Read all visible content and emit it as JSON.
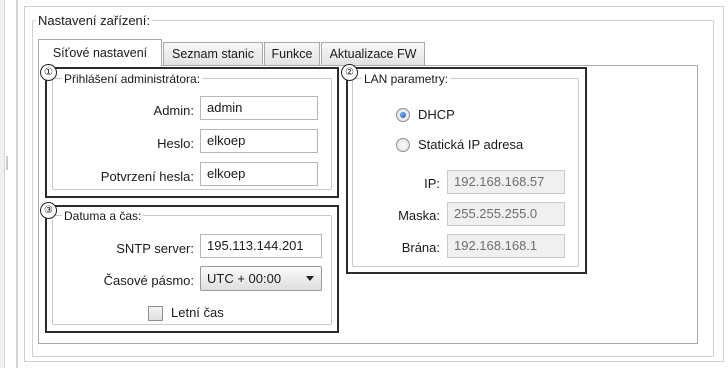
{
  "device_settings": {
    "legend": "Nastavení zařízení:",
    "tabs": [
      {
        "label": "Síťové nastavení",
        "active": true
      },
      {
        "label": "Seznam stanic",
        "active": false
      },
      {
        "label": "Funkce",
        "active": false
      },
      {
        "label": "Aktualizace FW",
        "active": false
      }
    ]
  },
  "admin": {
    "marker": "①",
    "legend": "Přihlášení administrátora:",
    "admin_label": "Admin:",
    "admin_value": "admin",
    "password_label": "Heslo:",
    "password_value": "elkoep",
    "confirm_label": "Potvrzení hesla:",
    "confirm_value": "elkoep"
  },
  "lan": {
    "marker": "②",
    "legend": "LAN parametry:",
    "dhcp_label": "DHCP",
    "dhcp_selected": true,
    "static_label": "Statická IP adresa",
    "ip_label": "IP:",
    "ip_value": "192.168.168.57",
    "mask_label": "Maska:",
    "mask_value": "255.255.255.0",
    "gateway_label": "Brána:",
    "gateway_value": "192.168.168.1"
  },
  "datetime": {
    "marker": "③",
    "legend": "Datuma a čas:",
    "sntp_label": "SNTP server:",
    "sntp_value": "195.113.144.201",
    "tz_label": "Časové pásmo:",
    "tz_value": "UTC + 00:00",
    "dst_label": "Letní čas",
    "dst_checked": false
  },
  "colors": {
    "radio_accent": "#1c57c9",
    "marker_box": "#2b2b2b"
  }
}
